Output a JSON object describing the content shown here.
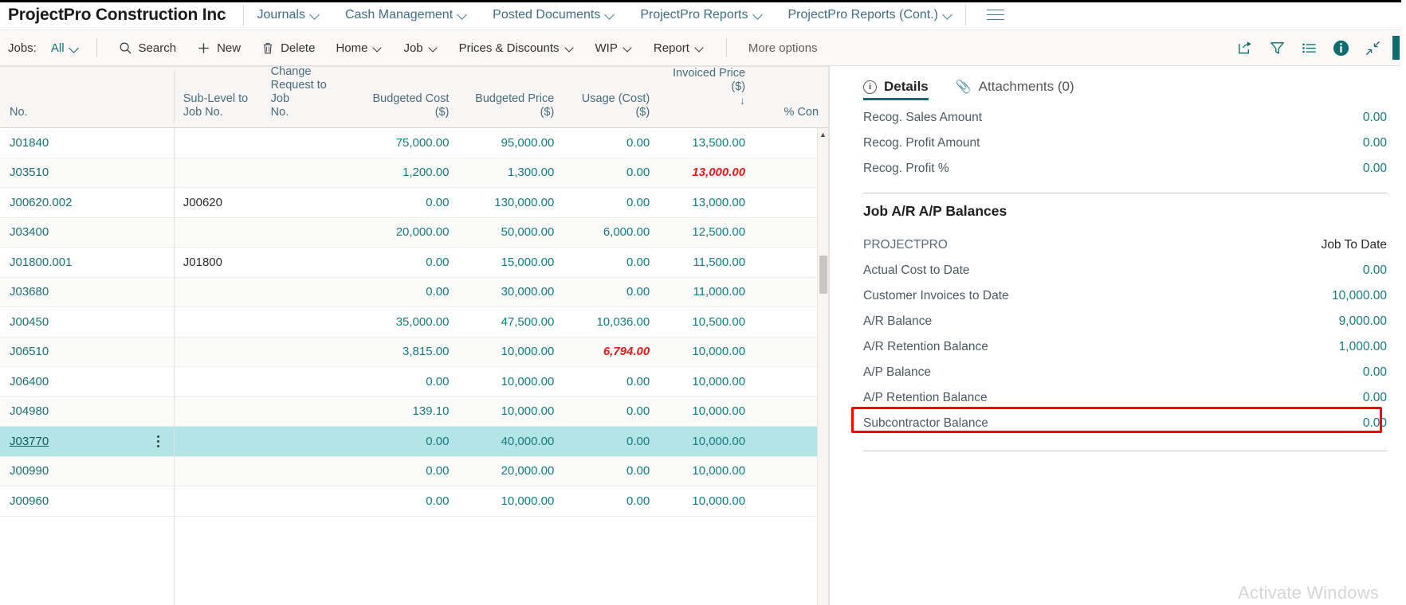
{
  "topnav": {
    "company": "ProjectPro Construction Inc",
    "items": [
      {
        "label": "Journals",
        "icon": "chevron-down-icon"
      },
      {
        "label": "Cash Management",
        "icon": "chevron-down-icon"
      },
      {
        "label": "Posted Documents",
        "icon": "chevron-down-icon"
      },
      {
        "label": "ProjectPro Reports",
        "icon": "chevron-down-icon"
      },
      {
        "label": "ProjectPro Reports (Cont.)",
        "icon": "chevron-down-icon"
      }
    ],
    "hamburger_icon": "hamburger-menu-icon"
  },
  "toolbar": {
    "jobs_label": "Jobs:",
    "filter_value": "All",
    "search_label": "Search",
    "new_label": "New",
    "delete_label": "Delete",
    "home_label": "Home",
    "job_label": "Job",
    "prices_label": "Prices & Discounts",
    "wip_label": "WIP",
    "report_label": "Report",
    "more_label": "More options",
    "icons": [
      "share-icon",
      "filter-icon",
      "list-icon",
      "info-icon",
      "collapse-icon"
    ]
  },
  "grid": {
    "columns": [
      {
        "key": "no",
        "label": "No.",
        "align": "left"
      },
      {
        "key": "sub",
        "label": "Sub-Level to\nJob No.",
        "align": "left"
      },
      {
        "key": "chg",
        "label": "Change\nRequest to Job\nNo.",
        "align": "left"
      },
      {
        "key": "bcost",
        "label": "Budgeted Cost ($)",
        "align": "right"
      },
      {
        "key": "bprice",
        "label": "Budgeted Price ($)",
        "align": "right"
      },
      {
        "key": "usage",
        "label": "Usage (Cost) ($)",
        "align": "right"
      },
      {
        "key": "inv",
        "label": "Invoiced Price ($)",
        "align": "right",
        "sort": "↓"
      },
      {
        "key": "pct",
        "label": "% Con",
        "align": "right"
      }
    ],
    "rows": [
      {
        "no": "J01840",
        "sub": "",
        "chg": "",
        "bcost": "75,000.00",
        "bprice": "95,000.00",
        "usage": "0.00",
        "inv": "13,500.00",
        "inv_alert": false,
        "usage_alert": false,
        "selected": false
      },
      {
        "no": "J03510",
        "sub": "",
        "chg": "",
        "bcost": "1,200.00",
        "bprice": "1,300.00",
        "usage": "0.00",
        "inv": "13,000.00",
        "inv_alert": true,
        "usage_alert": false,
        "selected": false
      },
      {
        "no": "J00620.002",
        "sub": "J00620",
        "chg": "",
        "bcost": "0.00",
        "bprice": "130,000.00",
        "usage": "0.00",
        "inv": "13,000.00",
        "inv_alert": false,
        "usage_alert": false,
        "selected": false
      },
      {
        "no": "J03400",
        "sub": "",
        "chg": "",
        "bcost": "20,000.00",
        "bprice": "50,000.00",
        "usage": "6,000.00",
        "inv": "12,500.00",
        "inv_alert": false,
        "usage_alert": false,
        "selected": false
      },
      {
        "no": "J01800.001",
        "sub": "J01800",
        "chg": "",
        "bcost": "0.00",
        "bprice": "15,000.00",
        "usage": "0.00",
        "inv": "11,500.00",
        "inv_alert": false,
        "usage_alert": false,
        "selected": false
      },
      {
        "no": "J03680",
        "sub": "",
        "chg": "",
        "bcost": "0.00",
        "bprice": "30,000.00",
        "usage": "0.00",
        "inv": "11,000.00",
        "inv_alert": false,
        "usage_alert": false,
        "selected": false
      },
      {
        "no": "J00450",
        "sub": "",
        "chg": "",
        "bcost": "35,000.00",
        "bprice": "47,500.00",
        "usage": "10,036.00",
        "inv": "10,500.00",
        "inv_alert": false,
        "usage_alert": false,
        "selected": false
      },
      {
        "no": "J06510",
        "sub": "",
        "chg": "",
        "bcost": "3,815.00",
        "bprice": "10,000.00",
        "usage": "6,794.00",
        "inv": "10,000.00",
        "inv_alert": false,
        "usage_alert": true,
        "selected": false
      },
      {
        "no": "J06400",
        "sub": "",
        "chg": "",
        "bcost": "0.00",
        "bprice": "10,000.00",
        "usage": "0.00",
        "inv": "10,000.00",
        "inv_alert": false,
        "usage_alert": false,
        "selected": false
      },
      {
        "no": "J04980",
        "sub": "",
        "chg": "",
        "bcost": "139.10",
        "bprice": "10,000.00",
        "usage": "0.00",
        "inv": "10,000.00",
        "inv_alert": false,
        "usage_alert": false,
        "selected": false
      },
      {
        "no": "J03770",
        "sub": "",
        "chg": "",
        "bcost": "0.00",
        "bprice": "40,000.00",
        "usage": "0.00",
        "inv": "10,000.00",
        "inv_alert": false,
        "usage_alert": false,
        "selected": true
      },
      {
        "no": "J00990",
        "sub": "",
        "chg": "",
        "bcost": "0.00",
        "bprice": "20,000.00",
        "usage": "0.00",
        "inv": "10,000.00",
        "inv_alert": false,
        "usage_alert": false,
        "selected": false
      },
      {
        "no": "J00960",
        "sub": "",
        "chg": "",
        "bcost": "0.00",
        "bprice": "10,000.00",
        "usage": "0.00",
        "inv": "10,000.00",
        "inv_alert": false,
        "usage_alert": false,
        "selected": false
      }
    ]
  },
  "factbox": {
    "tab_details": "Details",
    "tab_attachments": "Attachments (0)",
    "recog": [
      {
        "label": "Recog. Sales Amount",
        "value": "0.00"
      },
      {
        "label": "Recog. Profit Amount",
        "value": "0.00"
      },
      {
        "label": "Recog. Profit %",
        "value": "0.00"
      }
    ],
    "section_title": "Job A/R A/P Balances",
    "col_left": "PROJECTPRO",
    "col_right": "Job To Date",
    "balances": [
      {
        "label": "Actual Cost to Date",
        "value": "0.00",
        "highlight": false
      },
      {
        "label": "Customer Invoices to Date",
        "value": "10,000.00",
        "highlight": false
      },
      {
        "label": "A/R Balance",
        "value": "9,000.00",
        "highlight": false
      },
      {
        "label": "A/R Retention Balance",
        "value": "1,000.00",
        "highlight": true
      },
      {
        "label": "A/P Balance",
        "value": "0.00",
        "highlight": false
      },
      {
        "label": "A/P Retention Balance",
        "value": "0.00",
        "highlight": false
      },
      {
        "label": "Subcontractor Balance",
        "value": "0.00",
        "highlight": false
      }
    ]
  },
  "watermark": "Activate Windows",
  "colors": {
    "accent": "#0f6b6e",
    "link": "#157a80",
    "alert": "#e01b1b",
    "selected_row": "#b3e5e6",
    "highlight_box": "#ff0000"
  }
}
